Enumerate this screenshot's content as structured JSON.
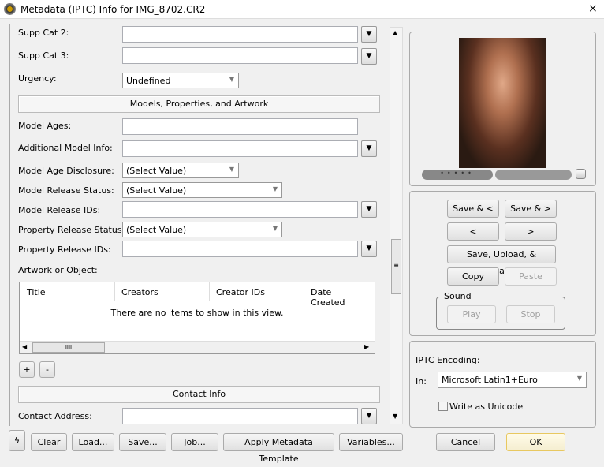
{
  "window": {
    "title": "Metadata (IPTC) Info for IMG_8702.CR2",
    "close": "×"
  },
  "fields": {
    "supp_cat_2": "Supp Cat 2:",
    "supp_cat_3": "Supp Cat 3:",
    "urgency": "Urgency:",
    "urgency_value": "Undefined",
    "section_models": "Models, Properties, and Artwork",
    "model_ages": "Model Ages:",
    "additional_model_info": "Additional Model Info:",
    "model_age_disclosure": "Model Age Disclosure:",
    "model_age_disclosure_value": "(Select Value)",
    "model_release_status": "Model Release Status:",
    "model_release_status_value": "(Select Value)",
    "model_release_ids": "Model Release IDs:",
    "property_release_status": "Property Release Status:",
    "property_release_status_value": "(Select Value)",
    "property_release_ids": "Property Release IDs:",
    "artwork": "Artwork or Object:",
    "section_contact": "Contact Info",
    "contact_address": "Contact Address:"
  },
  "artwork_table": {
    "columns": [
      "Title",
      "Creators",
      "Creator IDs",
      "Date Created"
    ],
    "empty": "There are no items to show in this view.",
    "add": "+",
    "remove": "-",
    "hthumb": "IIII"
  },
  "nav": {
    "save_prev": "Save & <",
    "save_next": "Save & >",
    "prev": "<",
    "next": ">",
    "save_upload": "Save, Upload, & Advance",
    "copy": "Copy",
    "paste": "Paste",
    "sound": "Sound",
    "play": "Play",
    "stop": "Stop"
  },
  "encoding": {
    "title": "IPTC Encoding:",
    "in": "In:",
    "value": "Microsoft Latin1+Euro",
    "unicode": "Write as Unicode"
  },
  "bottom": {
    "clear": "Clear",
    "load": "Load...",
    "save": "Save...",
    "job": "Job...",
    "template": "Apply Metadata Template",
    "variables": "Variables...",
    "cancel": "Cancel",
    "ok": "OK"
  }
}
